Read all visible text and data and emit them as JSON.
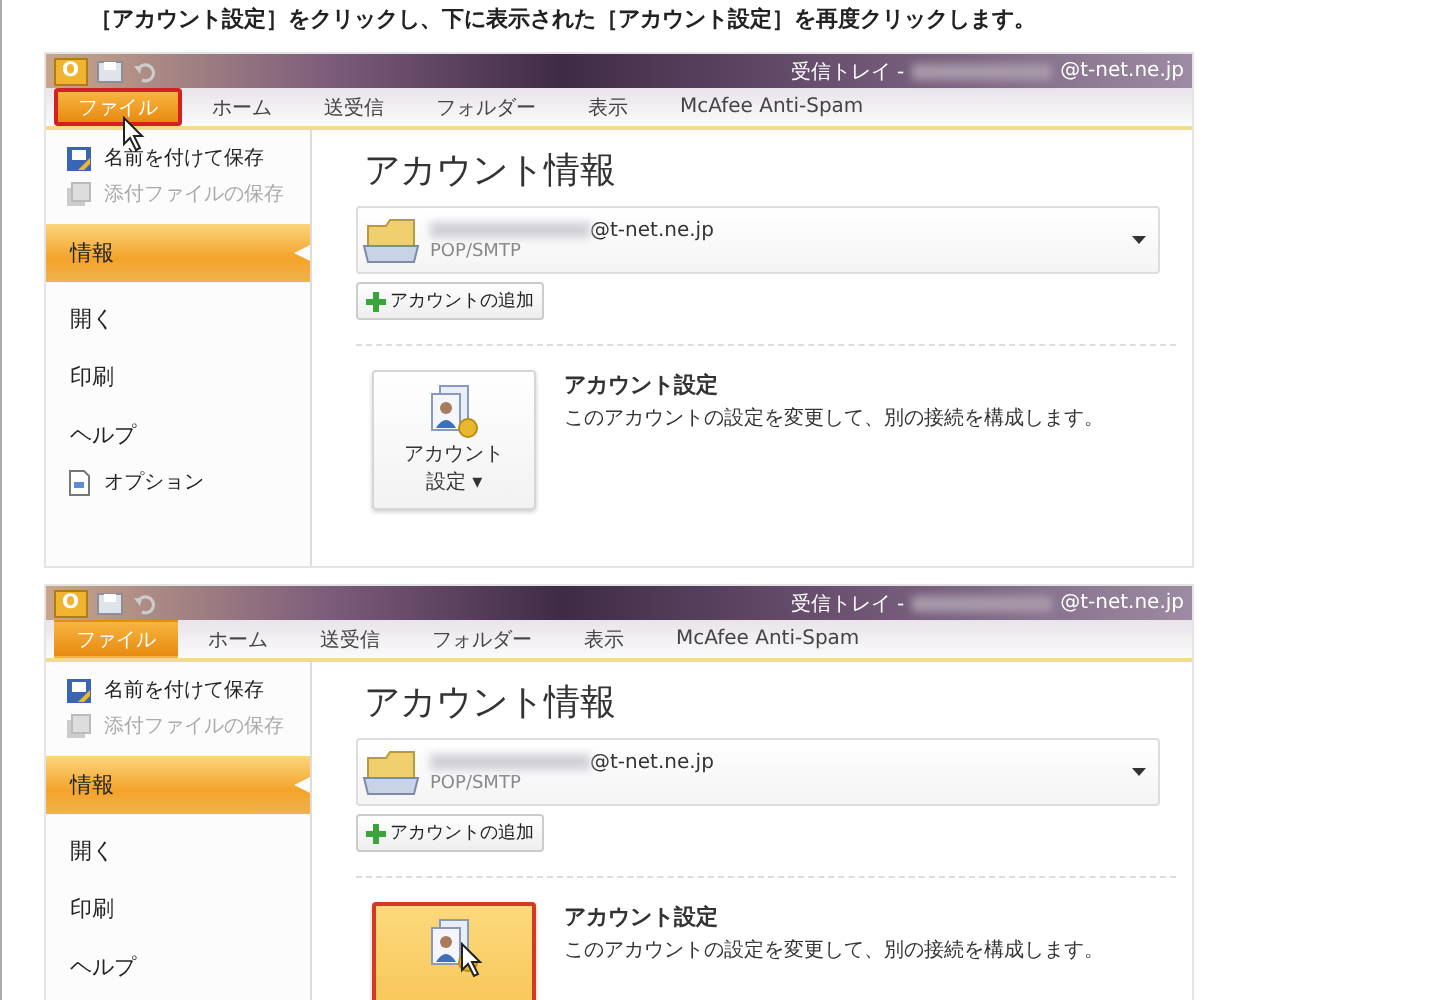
{
  "instruction": "［アカウント設定］をクリックし、下に表示された［アカウント設定］を再度クリックします。",
  "screenshots": [
    {
      "app_logo": "O",
      "title": "受信トレイ -",
      "title_email": "@t-net.ne.jp",
      "tabs": [
        {
          "label": "ファイル",
          "selected": true,
          "outlined": true,
          "pointed": true
        },
        {
          "label": "ホーム",
          "selected": false,
          "outlined": false,
          "pointed": false
        },
        {
          "label": "送受信",
          "selected": false,
          "outlined": false,
          "pointed": false
        },
        {
          "label": "フォルダー",
          "selected": false,
          "outlined": false,
          "pointed": false
        },
        {
          "label": "表示",
          "selected": false,
          "outlined": false,
          "pointed": false
        },
        {
          "label": "McAfee Anti-Spam",
          "selected": false,
          "outlined": false,
          "pointed": false
        }
      ],
      "sidebar": [
        {
          "kind": "command",
          "label": "名前を付けて保存",
          "disabled": false
        },
        {
          "kind": "command",
          "label": "添付ファイルの保存",
          "disabled": true
        },
        {
          "kind": "section",
          "label": "情報",
          "selected": true
        },
        {
          "kind": "section",
          "label": "開く",
          "selected": false
        },
        {
          "kind": "section",
          "label": "印刷",
          "selected": false
        },
        {
          "kind": "section",
          "label": "ヘルプ",
          "selected": false
        },
        {
          "kind": "command",
          "label": "オプション",
          "disabled": false
        }
      ],
      "heading": "アカウント情報",
      "account_email": "@t-net.ne.jp",
      "account_type": "POP/SMTP",
      "add_account": "アカウントの追加",
      "settings_button": {
        "label_lines": [
          "アカウント",
          "設定 ▾"
        ],
        "highlighted": false,
        "pointed": false
      },
      "settings_title": "アカウント設定",
      "settings_desc": "このアカウントの設定を変更して、別の接続を構成します。"
    },
    {
      "app_logo": "O",
      "title": "受信トレイ -",
      "title_email": "@t-net.ne.jp",
      "tabs": [
        {
          "label": "ファイル",
          "selected": true,
          "outlined": false,
          "pointed": false
        },
        {
          "label": "ホーム",
          "selected": false,
          "outlined": false,
          "pointed": false
        },
        {
          "label": "送受信",
          "selected": false,
          "outlined": false,
          "pointed": false
        },
        {
          "label": "フォルダー",
          "selected": false,
          "outlined": false,
          "pointed": false
        },
        {
          "label": "表示",
          "selected": false,
          "outlined": false,
          "pointed": false
        },
        {
          "label": "McAfee Anti-Spam",
          "selected": false,
          "outlined": false,
          "pointed": false
        }
      ],
      "sidebar": [
        {
          "kind": "command",
          "label": "名前を付けて保存",
          "disabled": false
        },
        {
          "kind": "command",
          "label": "添付ファイルの保存",
          "disabled": true
        },
        {
          "kind": "section",
          "label": "情報",
          "selected": true
        },
        {
          "kind": "section",
          "label": "開く",
          "selected": false
        },
        {
          "kind": "section",
          "label": "印刷",
          "selected": false
        },
        {
          "kind": "section",
          "label": "ヘルプ",
          "selected": false
        }
      ],
      "heading": "アカウント情報",
      "account_email": "@t-net.ne.jp",
      "account_type": "POP/SMTP",
      "add_account": "アカウントの追加",
      "settings_button": {
        "highlighted": true,
        "pointed": true
      },
      "settings_title": "アカウント設定",
      "settings_desc": "このアカウントの設定を変更して、別の接続を構成します。"
    }
  ]
}
